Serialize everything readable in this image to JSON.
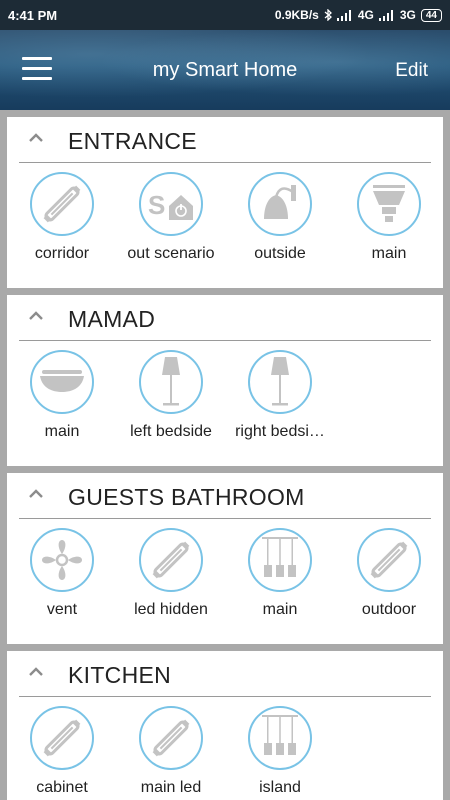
{
  "status": {
    "time": "4:41 PM",
    "speed": "0.9KB/s",
    "net1": "4G",
    "net2": "3G",
    "battery": "44"
  },
  "header": {
    "title": "my Smart Home",
    "edit_label": "Edit"
  },
  "colors": {
    "accent": "#79c3e6",
    "icon": "#c3c3c3",
    "header": "#25577c"
  },
  "rooms": [
    {
      "name": "ENTRANCE",
      "devices": [
        {
          "label": "corridor",
          "icon": "led-strip-icon"
        },
        {
          "label": "out scenario",
          "icon": "scenario-icon"
        },
        {
          "label": "outside",
          "icon": "wall-lamp-icon"
        },
        {
          "label": "main",
          "icon": "spotlight-icon"
        }
      ]
    },
    {
      "name": "MAMAD",
      "devices": [
        {
          "label": "main",
          "icon": "ceiling-light-icon"
        },
        {
          "label": "left bedside",
          "icon": "floor-lamp-icon"
        },
        {
          "label": "right bedsi…",
          "icon": "floor-lamp-icon"
        }
      ]
    },
    {
      "name": "GUESTS BATHROOM",
      "devices": [
        {
          "label": "vent",
          "icon": "fan-icon"
        },
        {
          "label": "led hidden",
          "icon": "led-strip-icon"
        },
        {
          "label": "main",
          "icon": "pendant-lights-icon"
        },
        {
          "label": "outdoor",
          "icon": "led-strip-icon"
        }
      ]
    },
    {
      "name": "KITCHEN",
      "devices": [
        {
          "label": "cabinet",
          "icon": "led-strip-icon"
        },
        {
          "label": "main led",
          "icon": "led-strip-icon"
        },
        {
          "label": "island",
          "icon": "pendant-lights-icon"
        }
      ]
    }
  ]
}
